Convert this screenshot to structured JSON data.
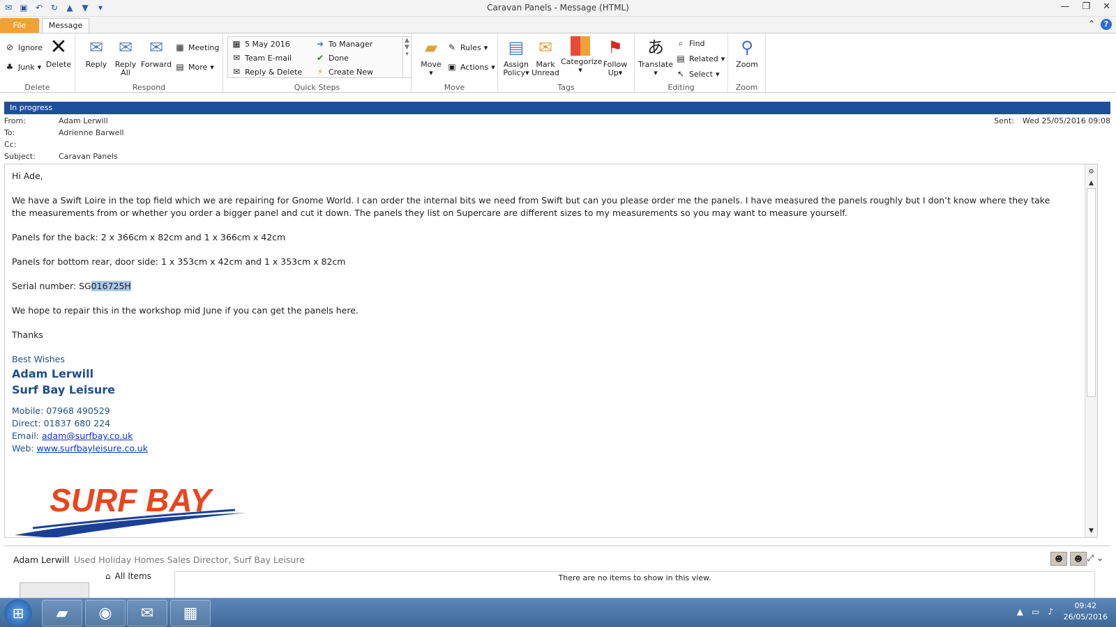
{
  "window": {
    "title": "Caravan Panels  -  Message (HTML)"
  },
  "tabs": {
    "file": "File",
    "message": "Message"
  },
  "ribbon": {
    "delete_group": {
      "label": "Delete",
      "ignore": "Ignore",
      "junk": "Junk",
      "delete": "Delete"
    },
    "respond_group": {
      "label": "Respond",
      "reply": "Reply",
      "reply_all_1": "Reply",
      "reply_all_2": "All",
      "forward": "Forward",
      "meeting": "Meeting",
      "more": "More"
    },
    "quick_steps": {
      "label": "Quick Steps",
      "items": [
        "5 May 2016",
        "To Manager",
        "Team E-mail",
        "Done",
        "Reply & Delete",
        "Create New"
      ]
    },
    "move_group": {
      "label": "Move",
      "move": "Move",
      "rules": "Rules",
      "actions": "Actions"
    },
    "tags_group": {
      "label": "Tags",
      "assign_1": "Assign",
      "assign_2": "Policy",
      "mark_1": "Mark",
      "mark_2": "Unread",
      "categorize": "Categorize",
      "follow_1": "Follow",
      "follow_2": "Up"
    },
    "editing_group": {
      "label": "Editing",
      "translate": "Translate",
      "find": "Find",
      "related": "Related",
      "select": "Select"
    },
    "zoom_group": {
      "label": "Zoom",
      "zoom": "Zoom"
    }
  },
  "status": "In progress",
  "header": {
    "from_label": "From:",
    "from": "Adam Lerwill",
    "to_label": "To:",
    "to": "Adrienne Barwell",
    "cc_label": "Cc:",
    "cc": "",
    "subject_label": "Subject:",
    "subject": "Caravan Panels",
    "sent_label": "Sent:",
    "sent": "Wed 25/05/2016 09:08"
  },
  "body": {
    "greeting": "Hi Ade,",
    "p1": "We have a Swift Loire in the top field which we are repairing for Gnome World.  I can order the internal bits we need from Swift but can you please order me the panels.  I have measured the panels roughly but I don’t know where they take the measurements from or whether you order a bigger panel and cut it down.  The panels they list on Supercare are different sizes to my measurements so you may want to measure yourself.",
    "p2": "Panels for the back:  2 x 366cm x 82cm and 1 x 366cm x 42cm",
    "p3": "Panels for bottom rear, door side:  1 x 353cm x 42cm and 1 x 353cm x 82cm",
    "serial_prefix": "Serial number: SG",
    "serial_highlight": "016725H",
    "p5": "We hope to repair this in the workshop mid June if you can get the panels here.",
    "thanks": "Thanks",
    "sig_wishes": "Best Wishes",
    "sig_name": "Adam Lerwill",
    "sig_company": "Surf Bay Leisure",
    "mobile": "Mobile: 07968 490529",
    "direct": "Direct:  01837 680 224",
    "email_label": "Email: ",
    "email": "adam@surfbay.co.uk",
    "web_label": "Web: ",
    "web": "www.surfbayleisure.co.uk",
    "logo_text": "SURF BAY"
  },
  "people_pane": {
    "name": "Adam Lerwill",
    "role": "Used Holiday Homes Sales Director, Surf Bay Leisure",
    "all_items": "All Items",
    "no_items": "There are no items to show in this view."
  },
  "taskbar": {
    "time": "09:42",
    "date": "26/05/2016"
  },
  "colors": {
    "status_bar": "#1e4f9c",
    "file_tab": "#f2a134",
    "signature": "#1f4e8c",
    "logo_red": "#e8461e",
    "logo_blue": "#1b3f96"
  }
}
